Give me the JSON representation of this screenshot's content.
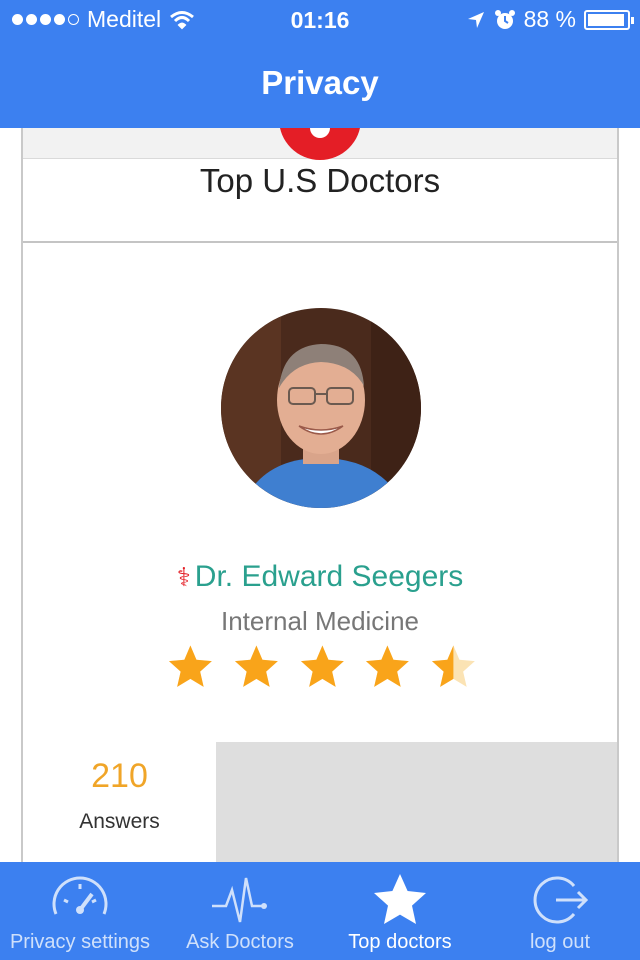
{
  "status_bar": {
    "carrier": "Meditel",
    "time": "01:16",
    "battery": "88 %"
  },
  "nav": {
    "title": "Privacy"
  },
  "main": {
    "section_title": "Top U.S Doctors",
    "doctor": {
      "name": "Dr. Edward Seegers",
      "specialty": "Internal Medicine",
      "rating": 4.5,
      "rating_max": 5,
      "answers_count": "210",
      "answers_label": "Answers"
    }
  },
  "tabbar": {
    "tabs": [
      {
        "label": "Privacy settings",
        "icon": "speedometer-icon"
      },
      {
        "label": "Ask Doctors",
        "icon": "heartbeat-icon"
      },
      {
        "label": "Top doctors",
        "icon": "star-icon",
        "active": true
      },
      {
        "label": "log out",
        "icon": "logout-icon"
      }
    ]
  },
  "colors": {
    "brand_blue": "#3c80f0",
    "doctor_name": "#2aa08e",
    "star": "#f9a41a",
    "answers": "#f0a528",
    "logo_red": "#e41e26"
  }
}
